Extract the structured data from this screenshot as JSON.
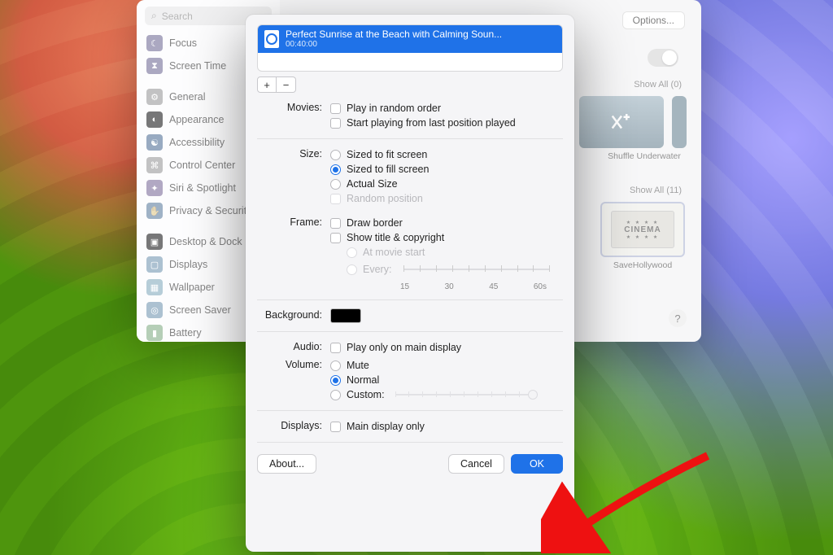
{
  "colors": {
    "accent": "#1f72e8"
  },
  "settings_window": {
    "search_placeholder": "Search",
    "options_button": "Options...",
    "show_all_top": "Show All (0)",
    "show_all_bottom": "Show All (11)",
    "thumb1_label": "Shuffle Underwater",
    "thumb2_label": "SaveHollywood",
    "cinema_text": "CINEMA",
    "help": "?"
  },
  "sidebar": {
    "items": [
      {
        "label": "Focus",
        "color": "#7a6ed9",
        "glyph": "☾"
      },
      {
        "label": "Screen Time",
        "color": "#7a6ed9",
        "glyph": "⧗"
      },
      {
        "label": "General",
        "color": "#9c9c9e",
        "glyph": "⚙"
      },
      {
        "label": "Appearance",
        "color": "#2b2b2d",
        "glyph": "◐"
      },
      {
        "label": "Accessibility",
        "color": "#2f7fe0",
        "glyph": "☯"
      },
      {
        "label": "Control Center",
        "color": "#9c9c9e",
        "glyph": "⌘"
      },
      {
        "label": "Siri & Spotlight",
        "color": "#8f6bdc",
        "glyph": "✦"
      },
      {
        "label": "Privacy & Security",
        "color": "#3a8ae0",
        "glyph": "✋"
      },
      {
        "label": "Desktop & Dock",
        "color": "#2b2b2d",
        "glyph": "▣"
      },
      {
        "label": "Displays",
        "color": "#4aa3e8",
        "glyph": "▢"
      },
      {
        "label": "Wallpaper",
        "color": "#56b7e8",
        "glyph": "▦"
      },
      {
        "label": "Screen Saver",
        "color": "#4aa3e8",
        "glyph": "◎"
      },
      {
        "label": "Battery",
        "color": "#57c060",
        "glyph": "▮"
      }
    ]
  },
  "sheet": {
    "file": {
      "title": "Perfect Sunrise at the Beach with Calming Soun...",
      "duration": "00:40:00"
    },
    "labels": {
      "movies": "Movies:",
      "size": "Size:",
      "frame": "Frame:",
      "background": "Background:",
      "audio": "Audio:",
      "volume": "Volume:",
      "displays": "Displays:"
    },
    "movies": {
      "random": "Play in random order",
      "resume": "Start playing from last position played"
    },
    "size": {
      "fit": "Sized to fit screen",
      "fill": "Sized to fill screen",
      "actual": "Actual Size",
      "random_pos": "Random position"
    },
    "frame": {
      "border": "Draw border",
      "title": "Show title & copyright",
      "at_start": "At movie start",
      "every": "Every:",
      "ticks": [
        "15",
        "30",
        "45",
        "60s"
      ]
    },
    "audio": {
      "main_only": "Play only on main display"
    },
    "volume": {
      "mute": "Mute",
      "normal": "Normal",
      "custom": "Custom:"
    },
    "displays": {
      "main_only": "Main display only"
    },
    "buttons": {
      "about": "About...",
      "cancel": "Cancel",
      "ok": "OK"
    }
  }
}
